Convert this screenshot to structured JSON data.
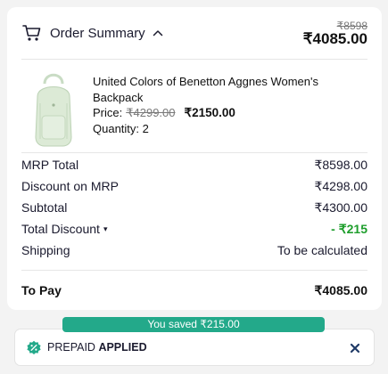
{
  "header": {
    "title": "Order Summary",
    "icon": "cart-icon",
    "toggle_icon": "chevron-up-icon",
    "old_total": "₹8598",
    "new_total": "₹4085.00"
  },
  "product": {
    "name": "United Colors of Benetton Aggnes Women's Backpack",
    "price_label": "Price:",
    "price_old": "₹4299.00",
    "price_new": "₹2150.00",
    "quantity": "Quantity: 2",
    "image_icon": "backpack-image"
  },
  "summary": {
    "mrp_total_label": "MRP Total",
    "mrp_total_value": "₹8598.00",
    "discount_mrp_label": "Discount on MRP",
    "discount_mrp_value": "₹4298.00",
    "subtotal_label": "Subtotal",
    "subtotal_value": "₹4300.00",
    "total_discount_label": "Total Discount",
    "total_discount_caret": "▾",
    "total_discount_value": "- ₹215",
    "shipping_label": "Shipping",
    "shipping_value": "To be calculated",
    "to_pay_label": "To Pay",
    "to_pay_value": "₹4085.00"
  },
  "coupon": {
    "saved_text": "You saved ₹215.00",
    "code": "PREPAID",
    "status": "APPLIED",
    "icon": "discount-badge-icon",
    "close_icon": "close-icon"
  },
  "colors": {
    "accent_teal": "#23a98a",
    "discount_green": "#1e9e2c",
    "text_dark": "#1a1a2e",
    "close_blue": "#1f3a66"
  }
}
